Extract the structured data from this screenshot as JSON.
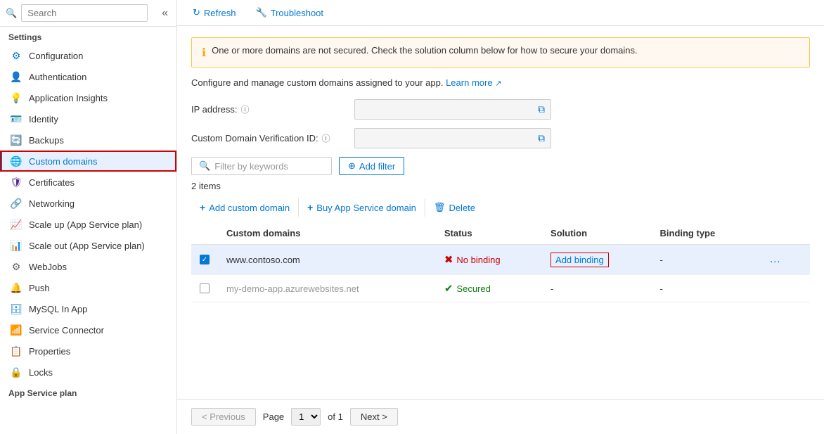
{
  "sidebar": {
    "search_placeholder": "Search",
    "settings_label": "Settings",
    "collapse_icon": "«",
    "items": [
      {
        "id": "configuration",
        "label": "Configuration",
        "icon": "⚙",
        "icon_color": "#0078d4"
      },
      {
        "id": "authentication",
        "label": "Authentication",
        "icon": "👤",
        "icon_color": "#5c2d91"
      },
      {
        "id": "application-insights",
        "label": "Application Insights",
        "icon": "💡",
        "icon_color": "#7b3fe4"
      },
      {
        "id": "identity",
        "label": "Identity",
        "icon": "🪪",
        "icon_color": "#ffaa00"
      },
      {
        "id": "backups",
        "label": "Backups",
        "icon": "🔄",
        "icon_color": "#0078d4"
      },
      {
        "id": "custom-domains",
        "label": "Custom domains",
        "icon": "🌐",
        "icon_color": "#0078d4",
        "active": true
      },
      {
        "id": "certificates",
        "label": "Certificates",
        "icon": "🛡",
        "icon_color": "#5c2d91"
      },
      {
        "id": "networking",
        "label": "Networking",
        "icon": "🔗",
        "icon_color": "#0078d4"
      },
      {
        "id": "scale-up",
        "label": "Scale up (App Service plan)",
        "icon": "📈",
        "icon_color": "#0078d4"
      },
      {
        "id": "scale-out",
        "label": "Scale out (App Service plan)",
        "icon": "📊",
        "icon_color": "#0078d4"
      },
      {
        "id": "webjobs",
        "label": "WebJobs",
        "icon": "⚙",
        "icon_color": "#666"
      },
      {
        "id": "push",
        "label": "Push",
        "icon": "🔔",
        "icon_color": "#0078d4"
      },
      {
        "id": "mysql-in-app",
        "label": "MySQL In App",
        "icon": "🗄",
        "icon_color": "#0078d4"
      },
      {
        "id": "service-connector",
        "label": "Service Connector",
        "icon": "📶",
        "icon_color": "#0078d4"
      },
      {
        "id": "properties",
        "label": "Properties",
        "icon": "📋",
        "icon_color": "#0078d4"
      },
      {
        "id": "locks",
        "label": "Locks",
        "icon": "🔒",
        "icon_color": "#0078d4"
      }
    ],
    "app_service_plan_label": "App Service plan"
  },
  "toolbar": {
    "refresh_label": "Refresh",
    "troubleshoot_label": "Troubleshoot"
  },
  "warning": {
    "text": "One or more domains are not secured. Check the solution column below for how to secure your domains."
  },
  "description": {
    "text": "Configure and manage custom domains assigned to your app.",
    "link_text": "Learn more",
    "link_icon": "↗"
  },
  "fields": {
    "ip_address_label": "IP address:",
    "ip_address_value": "",
    "custom_domain_verification_label": "Custom Domain Verification ID:",
    "custom_domain_verification_value": ""
  },
  "filter": {
    "placeholder": "Filter by keywords",
    "add_filter_label": "Add filter"
  },
  "items_count": "2 items",
  "actions": {
    "add_custom_domain": "Add custom domain",
    "buy_app_service_domain": "Buy App Service domain",
    "delete": "Delete"
  },
  "table": {
    "headers": {
      "custom_domains": "Custom domains",
      "status": "Status",
      "solution": "Solution",
      "binding_type": "Binding type"
    },
    "rows": [
      {
        "id": "row1",
        "checked": true,
        "domain": "www.contoso.com",
        "status_icon": "✗",
        "status_text": "No binding",
        "status_type": "error",
        "solution": "Add binding",
        "solution_type": "link",
        "binding_type": "-",
        "has_menu": true
      },
      {
        "id": "row2",
        "checked": false,
        "domain": "my-demo-app.azurewebsites.net",
        "status_icon": "✓",
        "status_text": "Secured",
        "status_type": "ok",
        "solution": "-",
        "solution_type": "text",
        "binding_type": "-",
        "has_menu": false
      }
    ]
  },
  "pagination": {
    "previous_label": "< Previous",
    "next_label": "Next >",
    "page_label": "Page",
    "of_label": "of 1",
    "current_page": "1",
    "page_options": [
      "1"
    ]
  }
}
